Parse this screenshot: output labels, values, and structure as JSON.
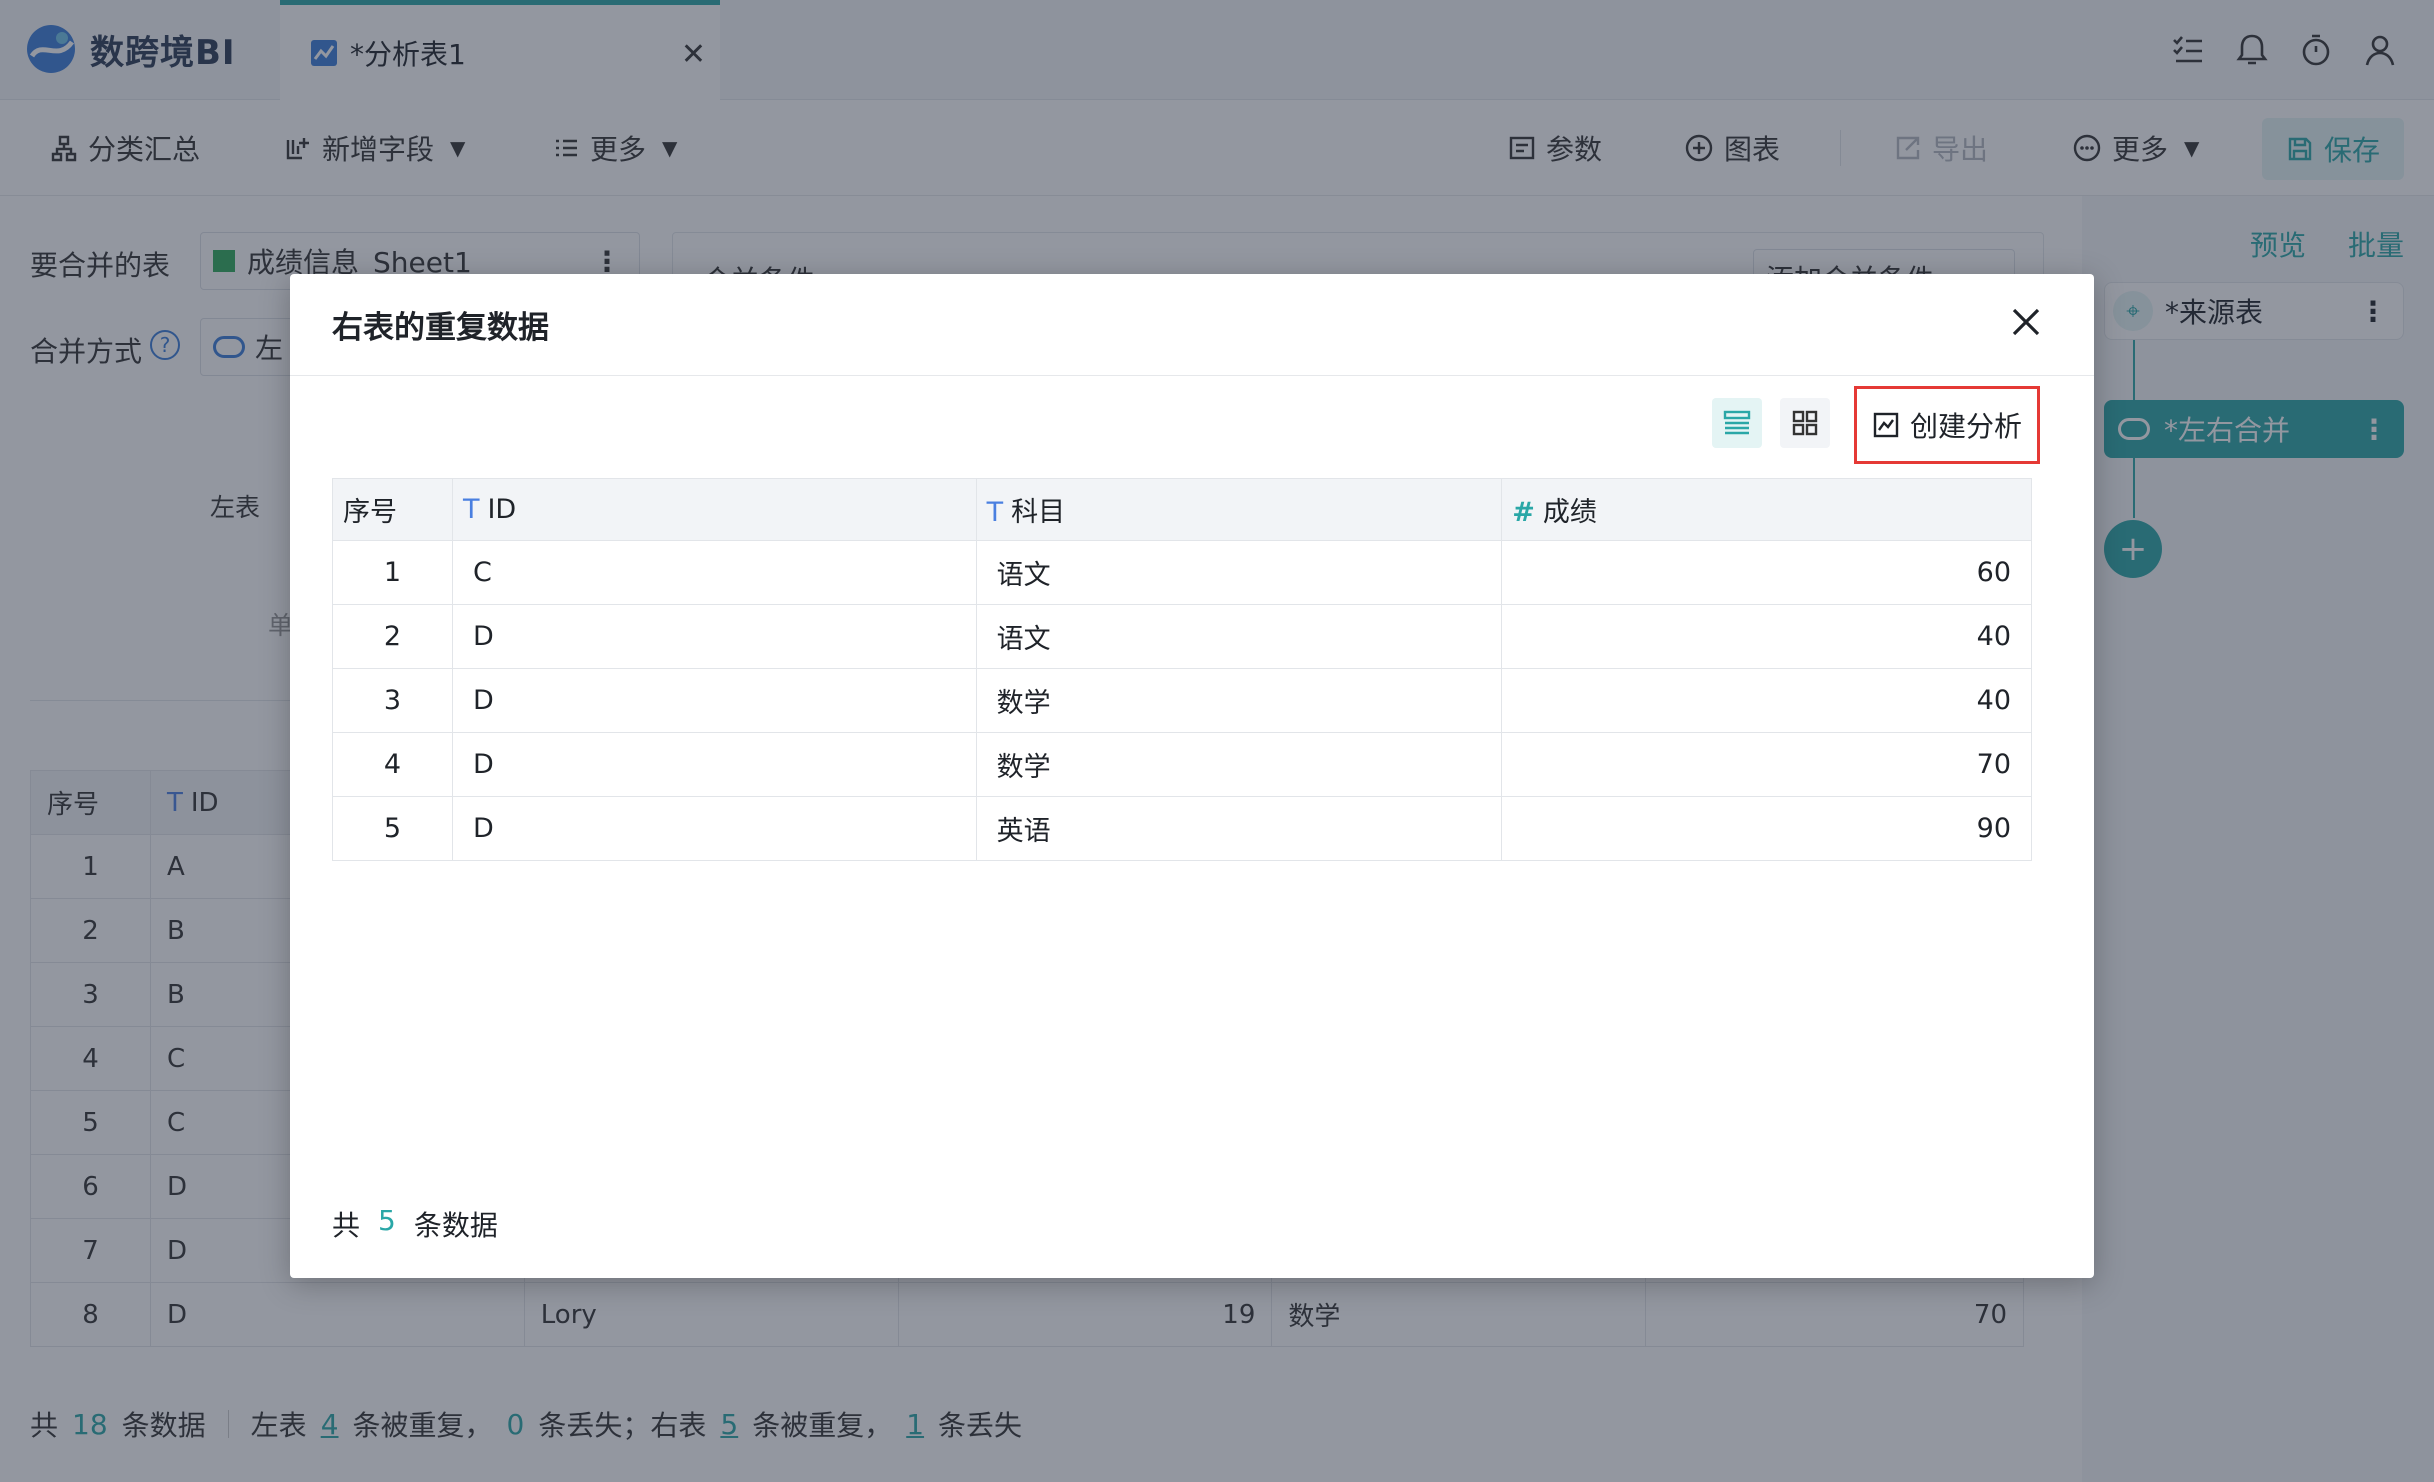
{
  "app": {
    "name": "数跨境BI"
  },
  "tab": {
    "label": "*分析表1"
  },
  "toolbar": {
    "group_label": "分类汇总",
    "add_field_label": "新增字段",
    "more_left_label": "更多",
    "params_label": "参数",
    "chart_label": "图表",
    "export_label": "导出",
    "more_right_label": "更多",
    "save_label": "保存"
  },
  "background": {
    "merge_tables_label": "要合并的表",
    "table_name": "成绩信息_Sheet1",
    "merge_condition_label": "合并条件",
    "add_condition_label": "添加合并条件",
    "merge_method_label": "合并方式",
    "merge_method_value": "左",
    "left_table_label": "左表",
    "single_label": "单",
    "table": {
      "headers": [
        "序号",
        "ID"
      ],
      "rows": [
        {
          "seq": "1",
          "id": "A"
        },
        {
          "seq": "2",
          "id": "B"
        },
        {
          "seq": "3",
          "id": "B"
        },
        {
          "seq": "4",
          "id": "C"
        },
        {
          "seq": "5",
          "id": "C"
        },
        {
          "seq": "6",
          "id": "D"
        },
        {
          "seq": "7",
          "id": "D"
        }
      ],
      "last_row": {
        "seq": "8",
        "id": "D",
        "name": "Lory",
        "age": "19",
        "subject": "数学",
        "score": "70"
      }
    },
    "status": {
      "total_prefix": "共",
      "total": "18",
      "total_suffix": "条数据",
      "left_label": "左表",
      "left_dup": "4",
      "dup_text": "条被重复，",
      "left_lost": "0",
      "lost_text_left": "条丢失；右表",
      "right_dup": "5",
      "dup_text2": "条被重复，",
      "right_lost": "1",
      "lost_text_right": "条丢失"
    }
  },
  "side_panel": {
    "preview_label": "预览",
    "batch_label": "批量",
    "source_node": "*来源表",
    "merge_node": "*左右合并"
  },
  "modal": {
    "title": "右表的重复数据",
    "create_analysis_label": "创建分析",
    "columns": [
      "序号",
      "ID",
      "科目",
      "成绩"
    ],
    "rows": [
      {
        "seq": "1",
        "id": "C",
        "subject": "语文",
        "score": "60"
      },
      {
        "seq": "2",
        "id": "D",
        "subject": "语文",
        "score": "40"
      },
      {
        "seq": "3",
        "id": "D",
        "subject": "数学",
        "score": "40"
      },
      {
        "seq": "4",
        "id": "D",
        "subject": "数学",
        "score": "70"
      },
      {
        "seq": "5",
        "id": "D",
        "subject": "英语",
        "score": "90"
      }
    ],
    "footer": {
      "prefix": "共",
      "count": "5",
      "suffix": "条数据"
    }
  },
  "colors": {
    "accent": "#2aa7a7",
    "highlight_border": "#e53935"
  }
}
